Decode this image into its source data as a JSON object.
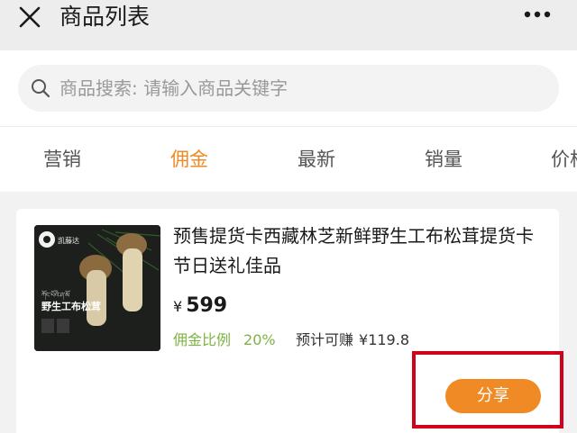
{
  "header": {
    "title": "商品列表",
    "close_icon": "close-icon",
    "more_icon": "more-dots-icon"
  },
  "search": {
    "placeholder": "商品搜索: 请输入商品关键字",
    "value": ""
  },
  "tabs": [
    {
      "label": "营销",
      "active": false
    },
    {
      "label": "佣金",
      "active": true
    },
    {
      "label": "最新",
      "active": false
    },
    {
      "label": "销量",
      "active": false
    },
    {
      "label": "价格",
      "active": false
    }
  ],
  "product": {
    "title": "预售提货卡西藏林芝新鲜野生工布松茸提货卡 节日送礼佳品",
    "price_symbol": "¥",
    "price": "599",
    "commission_label": "佣金比例",
    "commission_rate": "20%",
    "earn_label": "预计可赚",
    "earn_amount": "¥119.8",
    "share_label": "分享",
    "image": {
      "brand_text": "凯藤达",
      "tibetan_text": "ཀོང་པོའི་ཤ་མོ",
      "product_text": "野生工布松茸"
    }
  },
  "colors": {
    "accent": "#f08a24",
    "commission_green": "#7cb342",
    "highlight_red": "#d0021b"
  }
}
